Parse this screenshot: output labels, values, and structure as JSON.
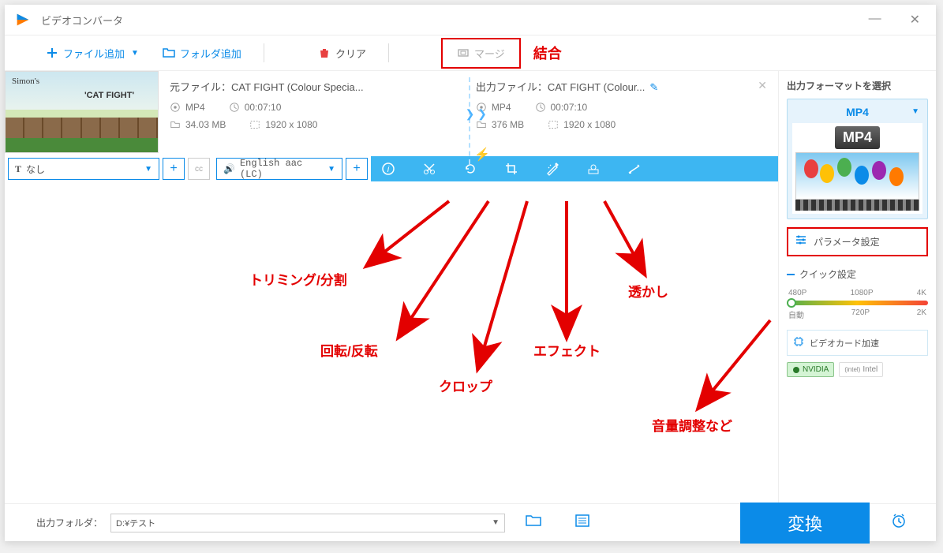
{
  "window": {
    "title": "ビデオコンバータ"
  },
  "toolbar": {
    "add_file": "ファイル追加",
    "add_folder": "フォルダ追加",
    "clear": "クリア",
    "merge": "マージ"
  },
  "annotations": {
    "merge": "結合",
    "trim": "トリミング/分割",
    "rotate": "回転/反転",
    "crop": "クロップ",
    "effect": "エフェクト",
    "watermark": "透かし",
    "volume": "音量調整など"
  },
  "file": {
    "thumb_author": "Simon's",
    "thumb_title": "'CAT FIGHT'",
    "source_label": "元ファイル：",
    "source_name": "CAT FIGHT (Colour Specia...",
    "output_label": "出力ファイル：",
    "output_name": "CAT FIGHT (Colour...",
    "src": {
      "format": "MP4",
      "duration": "00:07:10",
      "size": "34.03 MB",
      "resolution": "1920 x 1080"
    },
    "out": {
      "format": "MP4",
      "duration": "00:07:10",
      "size": "376 MB",
      "resolution": "1920 x 1080"
    }
  },
  "edit_row": {
    "subtitle": "なし",
    "audio": "English aac (LC)"
  },
  "right_panel": {
    "title": "出力フォーマットを選択",
    "format": "MP4",
    "format_badge": "MP4",
    "param_settings": "パラメータ設定",
    "quick_settings": "クイック設定",
    "quality": {
      "row1": [
        "480P",
        "1080P",
        "4K"
      ],
      "row2": [
        "自動",
        "720P",
        "2K"
      ]
    },
    "hw_accel": "ビデオカード加速",
    "nvidia": "NVIDIA",
    "intel": "Intel"
  },
  "bottom": {
    "output_folder_label": "出力フォルダ：",
    "output_path": "D:¥テスト",
    "convert": "変換"
  }
}
